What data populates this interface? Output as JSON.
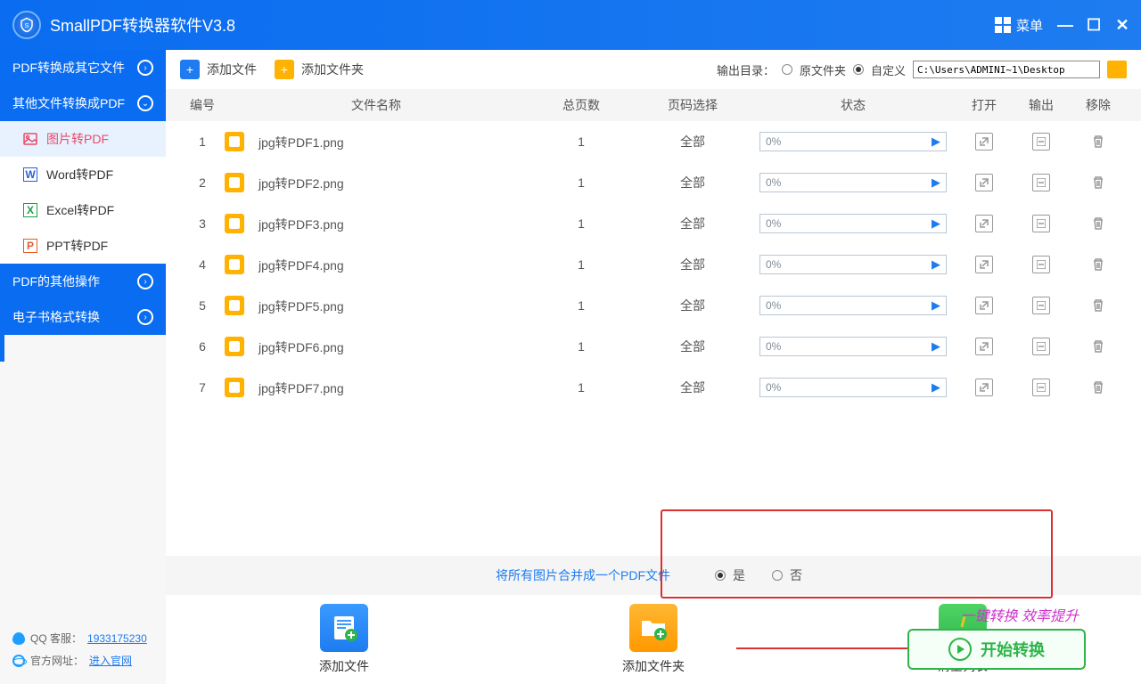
{
  "titlebar": {
    "title": "SmallPDF转换器软件V3.8",
    "menu": "菜单"
  },
  "sidebar": {
    "cats": [
      {
        "label": "PDF转换成其它文件"
      },
      {
        "label": "其他文件转换成PDF"
      },
      {
        "label": "PDF的其他操作"
      },
      {
        "label": "电子书格式转换"
      }
    ],
    "subs": [
      {
        "label": "图片转PDF"
      },
      {
        "label": "Word转PDF"
      },
      {
        "label": "Excel转PDF"
      },
      {
        "label": "PPT转PDF"
      }
    ],
    "qq_label": "QQ 客服：",
    "qq_value": "1933175230",
    "site_label": "官方网址：",
    "site_value": "进入官网"
  },
  "toolbar": {
    "add_file": "添加文件",
    "add_folder": "添加文件夹",
    "output_label": "输出目录：",
    "opt_source": "原文件夹",
    "opt_custom": "自定义",
    "path": "C:\\Users\\ADMINI~1\\Desktop"
  },
  "table": {
    "h_num": "编号",
    "h_name": "文件名称",
    "h_pages": "总页数",
    "h_sel": "页码选择",
    "h_status": "状态",
    "h_open": "打开",
    "h_out": "输出",
    "h_del": "移除",
    "rows": [
      {
        "n": "1",
        "name": "jpg转PDF1.png",
        "pages": "1",
        "sel": "全部",
        "pct": "0%"
      },
      {
        "n": "2",
        "name": "jpg转PDF2.png",
        "pages": "1",
        "sel": "全部",
        "pct": "0%"
      },
      {
        "n": "3",
        "name": "jpg转PDF3.png",
        "pages": "1",
        "sel": "全部",
        "pct": "0%"
      },
      {
        "n": "4",
        "name": "jpg转PDF4.png",
        "pages": "1",
        "sel": "全部",
        "pct": "0%"
      },
      {
        "n": "5",
        "name": "jpg转PDF5.png",
        "pages": "1",
        "sel": "全部",
        "pct": "0%"
      },
      {
        "n": "6",
        "name": "jpg转PDF6.png",
        "pages": "1",
        "sel": "全部",
        "pct": "0%"
      },
      {
        "n": "7",
        "name": "jpg转PDF7.png",
        "pages": "1",
        "sel": "全部",
        "pct": "0%"
      }
    ]
  },
  "merge": {
    "text": "将所有图片合并成一个PDF文件",
    "yes": "是",
    "no": "否"
  },
  "bottom": {
    "add_file": "添加文件",
    "add_folder": "添加文件夹",
    "clear": "清空列表",
    "promo": "一键转换  效率提升",
    "start": "开始转换"
  }
}
